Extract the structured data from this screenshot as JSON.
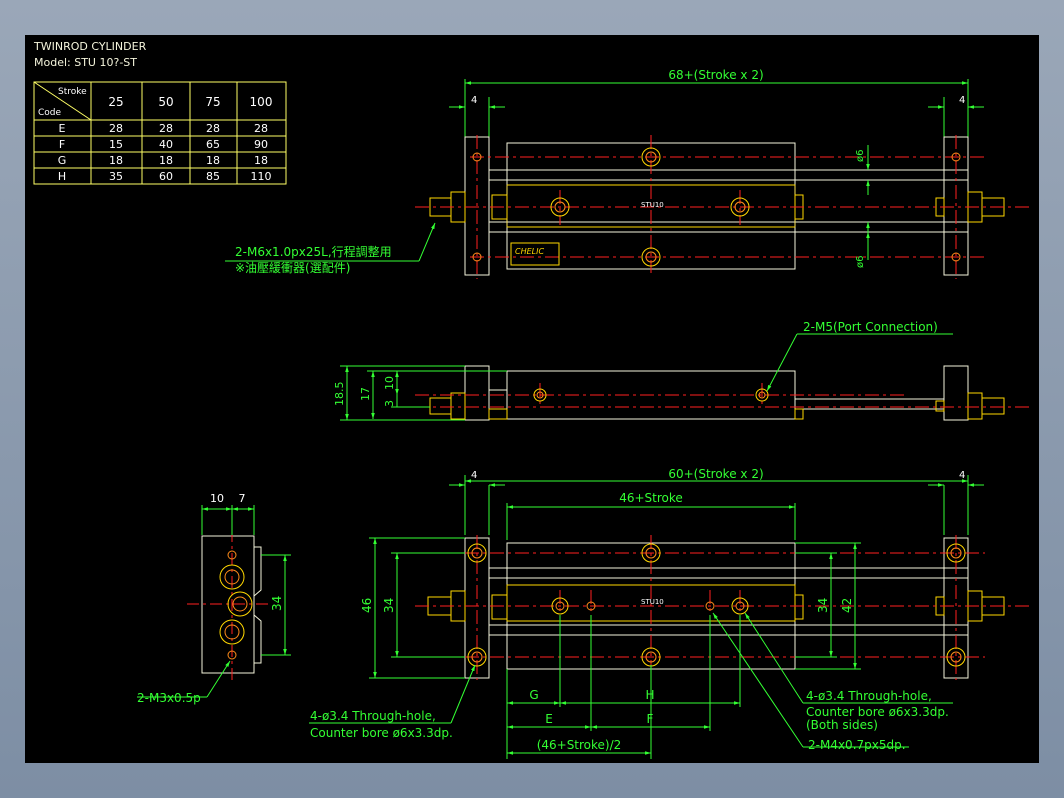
{
  "title": {
    "line1": "TWINROD CYLINDER",
    "line2": "Model: STU 10?-ST"
  },
  "table": {
    "header_stroke": "Stroke",
    "header_code": "Code",
    "columns": [
      "25",
      "50",
      "75",
      "100"
    ],
    "rows": [
      {
        "code": "E",
        "values": [
          "28",
          "28",
          "28",
          "28"
        ]
      },
      {
        "code": "F",
        "values": [
          "15",
          "40",
          "65",
          "90"
        ]
      },
      {
        "code": "G",
        "values": [
          "18",
          "18",
          "18",
          "18"
        ]
      },
      {
        "code": "H",
        "values": [
          "35",
          "60",
          "85",
          "110"
        ]
      }
    ]
  },
  "top_view": {
    "overall_dim": "68+(Stroke x 2)",
    "left_dim": "4",
    "right_dim": "4",
    "dia_top": "ø6",
    "dia_bottom": "ø6",
    "body_label": "STU10",
    "brand_label": "CHELIC",
    "callout_line1": "2-M6x1.0px25L,行程調整用",
    "callout_line2": "※油壓緩衝器(選配件)"
  },
  "side_view": {
    "port_callout": "2-M5(Port Connection)",
    "dim_185": "18.5",
    "dim_17": "17",
    "dim_3": "3",
    "dim_10": "10"
  },
  "bottom_view": {
    "overall_dim": "60+(Stroke x 2)",
    "inner_dim": "46+Stroke",
    "left_dim": "4",
    "right_dim": "4",
    "dim_46": "46",
    "dim_34_left": "34",
    "dim_34_right": "34",
    "dim_42": "42",
    "dim_G": "G",
    "dim_H": "H",
    "dim_E": "E",
    "dim_F": "F",
    "half_dim": "(46+Stroke)/2",
    "body_label": "STU10",
    "callout_left_1": "4-ø3.4 Through-hole,",
    "callout_left_2": "Counter bore ø6x3.3dp.",
    "callout_right_1": "4-ø3.4 Through-hole,",
    "callout_right_2": "Counter bore ø6x3.3dp.",
    "callout_right_3": "(Both sides)",
    "callout_m4": "2-M4x0.7px5dp."
  },
  "end_view": {
    "dim_10": "10",
    "dim_7": "7",
    "dim_34": "34",
    "callout": "2-M3x0.5p"
  },
  "colors": {
    "background": "#000000",
    "outline": "#f5f5dc",
    "dimension": "#33ff33",
    "centerline": "#ff2020",
    "hardware": "#ffd700",
    "hole": "#ff8c1a"
  }
}
